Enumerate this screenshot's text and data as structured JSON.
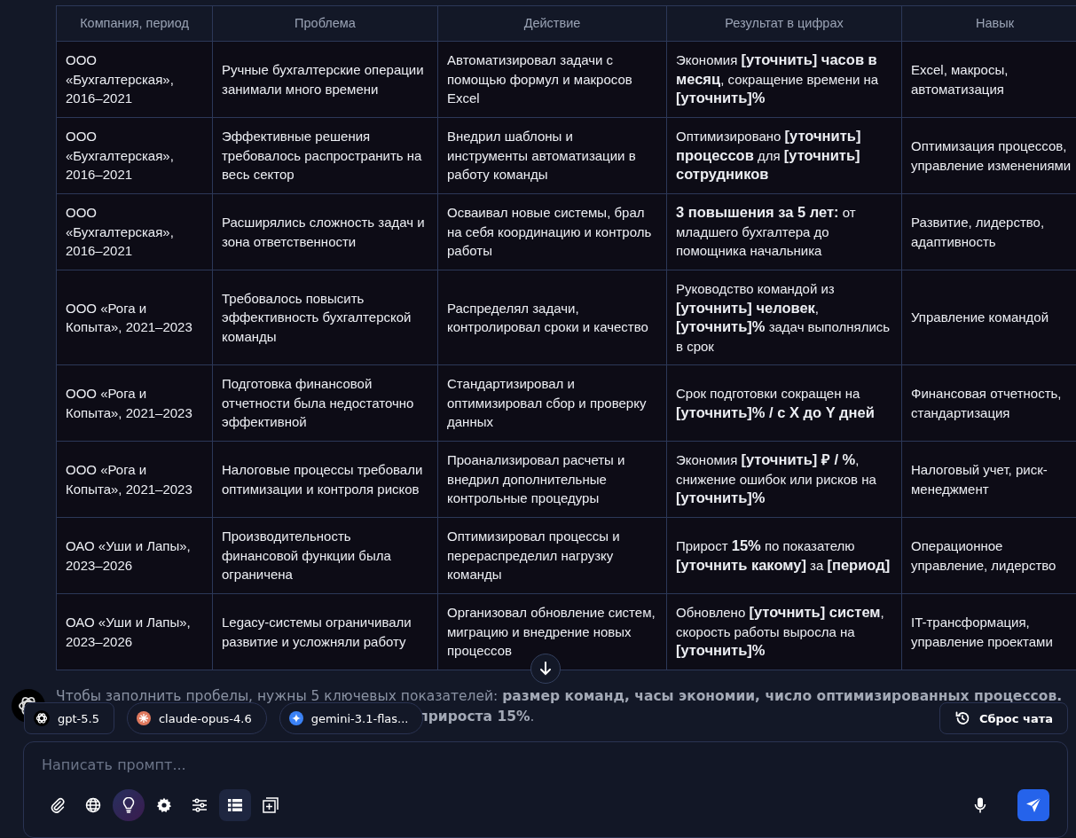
{
  "table": {
    "columns": [
      "Компания, период",
      "Проблема",
      "Действие",
      "Результат в цифрах",
      "Навык"
    ],
    "rows": [
      {
        "cells": [
          "ООО «Бухгалтерская», 2016–2021",
          "Ручные бухгалтерские операции занимали много времени",
          "Автоматизировал задачи с помощью формул и макросов Excel",
          "Экономия **[уточнить] часов в месяц**, сокращение времени на **[уточнить]%**",
          "Excel, макросы, автоматизация"
        ]
      },
      {
        "cells": [
          "ООО «Бухгалтерская», 2016–2021",
          "Эффективные решения требовалось распространить на весь сектор",
          "Внедрил шаблоны и инструменты автоматизации в работу команды",
          "Оптимизировано **[уточнить] процессов** для **[уточнить] сотрудников**",
          "Оптимизация процессов, управление изменениями"
        ]
      },
      {
        "cells": [
          "ООО «Бухгалтерская», 2016–2021",
          "Расширялись сложность задач и зона ответственности",
          "Осваивал новые системы, брал на себя координацию и контроль работы",
          "**3 повышения за 5 лет:** от младшего бухгалтера до помощника начальника",
          "Развитие, лидерство, адаптивность"
        ]
      },
      {
        "cells": [
          "ООО «Рога и Копыта», 2021–2023",
          "Требовалось повысить эффективность бухгалтерской команды",
          "Распределял задачи, контролировал сроки и качество",
          "Руководство командой из **[уточнить] человек**, **[уточнить]%** задач выполнялись в срок",
          "Управление командой"
        ]
      },
      {
        "cells": [
          "ООО «Рога и Копыта», 2021–2023",
          "Подготовка финансовой отчетности была недостаточно эффективной",
          "Стандартизировал и оптимизировал сбор и проверку данных",
          "Срок подготовки сокращен на **[уточнить]% / с X до Y дней**",
          "Финансовая отчетность, стандартизация"
        ]
      },
      {
        "cells": [
          "ООО «Рога и Копыта», 2021–2023",
          "Налоговые процессы требовали оптимизации и контроля рисков",
          "Проанализировал расчеты и внедрил дополнительные контрольные процедуры",
          "Экономия **[уточнить] ₽ / %**, снижение ошибок или рисков на **[уточнить]%**",
          "Налоговый учет, риск-менеджмент"
        ]
      },
      {
        "cells": [
          "ОАО «Уши и Лапы», 2023–2026",
          "Производительность финансовой функции была ограничена",
          "Оптимизировал процессы и перераспределил нагрузку команды",
          "Прирост **15%** по показателю **[уточнить какому]** за **[период]**",
          "Операционное управление, лидерство"
        ]
      },
      {
        "cells": [
          "ОАО «Уши и Лапы», 2023–2026",
          "Legacy-системы ограничивали развитие и усложняли работу",
          "Организовал обновление систем, миграцию и внедрение новых процессов",
          "Обновлено **[уточнить] систем**, скорость работы выросла на **[уточнить]%**",
          "IT-трансформация, управление проектами"
        ]
      }
    ]
  },
  "message": {
    "line_1": "Чтобы заполнить пробелы, нужны 5 ключевых показателей: **размер команд, часы экономии, число оптимизированных процессов.**",
    "line_2_end": "**прироста 15%**."
  },
  "models": [
    {
      "label": "gpt-5.5",
      "kind": "gpt",
      "selected": true
    },
    {
      "label": "claude-opus-4.6",
      "kind": "claude",
      "selected": false
    },
    {
      "label": "gemini-3.1-flas...",
      "kind": "gemini",
      "selected": false
    }
  ],
  "reset_button": "Сброс чата",
  "composer": {
    "placeholder": "Написать промпт...",
    "tools": [
      {
        "kind": "attach",
        "active": false
      },
      {
        "kind": "globe",
        "active": false
      },
      {
        "kind": "idea",
        "active": true
      },
      {
        "kind": "settings",
        "active": false
      },
      {
        "kind": "sliders",
        "active": false
      },
      {
        "kind": "list",
        "active": true
      },
      {
        "kind": "add",
        "active": false
      }
    ]
  }
}
